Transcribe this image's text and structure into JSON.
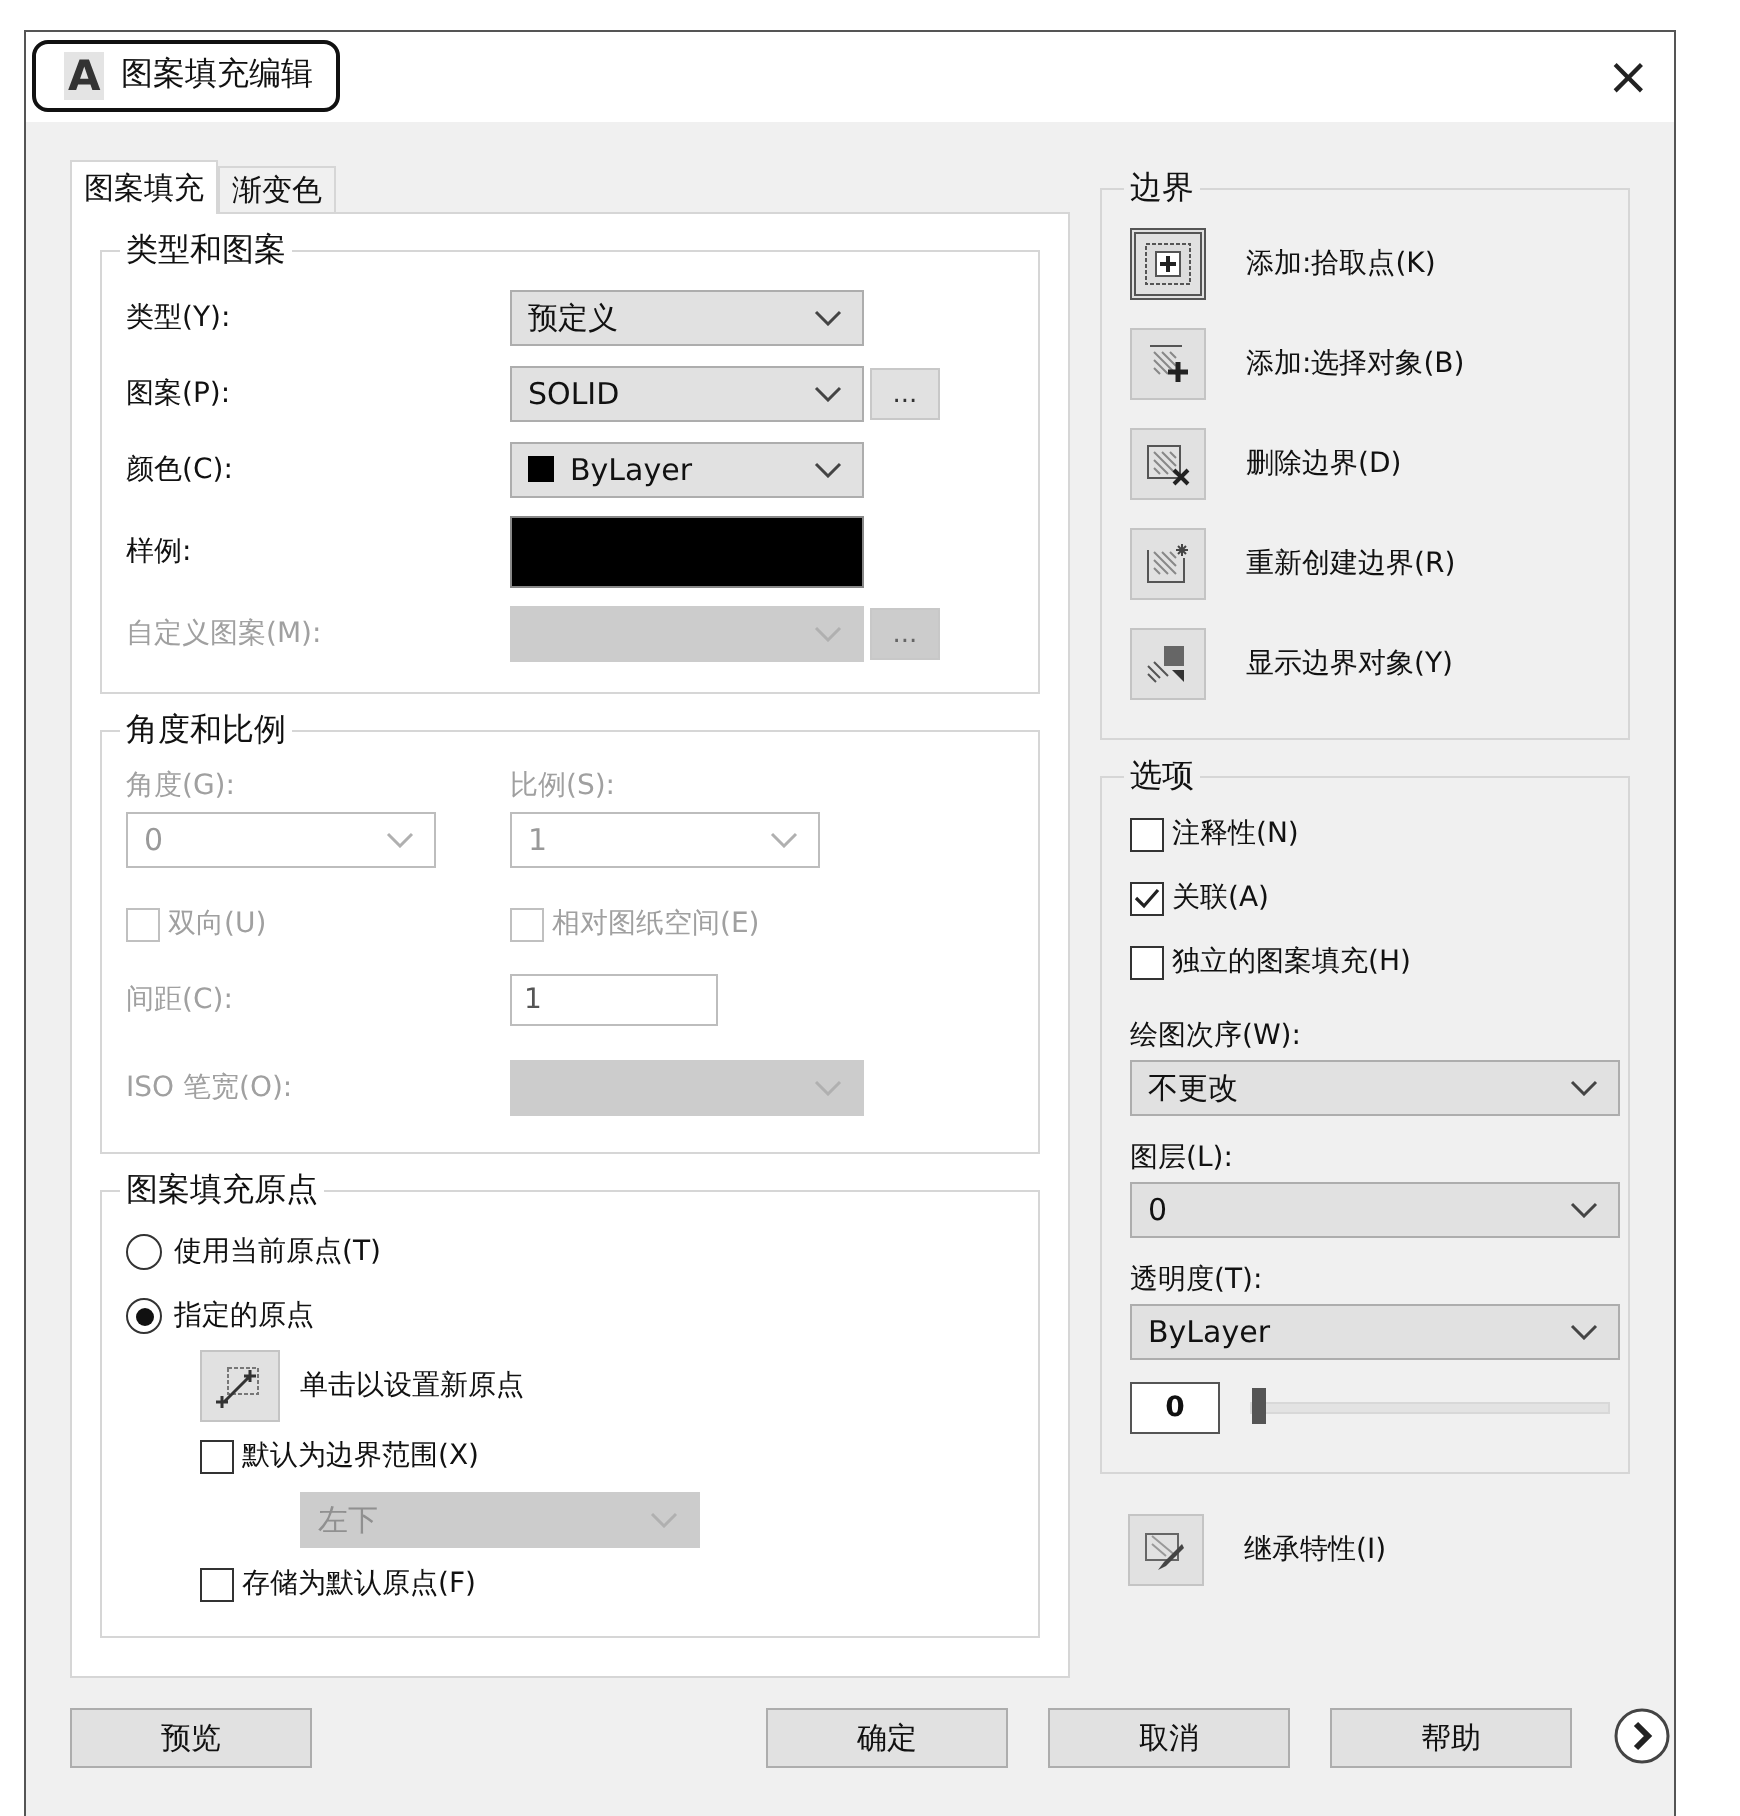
{
  "window": {
    "logo": "A",
    "title": "图案填充编辑",
    "close": "×"
  },
  "tabs": [
    {
      "label": "图案填充",
      "selected": true
    },
    {
      "label": "渐变色",
      "selected": false
    }
  ],
  "type_pattern": {
    "title": "类型和图案",
    "rows": [
      {
        "kind": "select",
        "label": "类型(Y):",
        "value": "预定义",
        "disabled": false
      },
      {
        "kind": "select",
        "label": "图案(P):",
        "value": "SOLID",
        "disabled": false,
        "browse": "..."
      },
      {
        "kind": "color_select",
        "label": "颜色(C):",
        "value": "ByLayer",
        "disabled": false
      },
      {
        "kind": "swatch",
        "label": "样例:",
        "disabled": false
      },
      {
        "kind": "select",
        "label": "自定义图案(M):",
        "disabled": true,
        "browse": "..."
      }
    ]
  },
  "angle_scale": {
    "title": "角度和比例",
    "disabled": true,
    "angle": {
      "label": "角度(G):",
      "value": "0"
    },
    "scale": {
      "label": "比例(S):",
      "value": "1"
    },
    "checkboxes": [
      {
        "label": "双向(U)",
        "checked": false
      },
      {
        "label": "相对图纸空间(E)",
        "checked": false
      }
    ],
    "spacing": {
      "label": "间距(C):",
      "value": "1"
    },
    "iso": {
      "label": "ISO 笔宽(O):"
    }
  },
  "origin": {
    "title": "图案填充原点",
    "radios": [
      {
        "label": "使用当前原点(T)",
        "selected": false
      },
      {
        "label": "指定的原点",
        "selected": true
      }
    ],
    "set_button": "单击以设置新原点",
    "default_extent": {
      "label": "默认为边界范围(X)",
      "checked": false
    },
    "position": {
      "value": "左下",
      "disabled": true
    },
    "store": {
      "label": "存储为默认原点(F)",
      "checked": false
    }
  },
  "boundaries": {
    "title": "边界",
    "buttons": [
      {
        "kind": "pick",
        "label": "添加:拾取点(K)",
        "selected": true
      },
      {
        "kind": "select",
        "label": "添加:选择对象(B)",
        "selected": false
      },
      {
        "kind": "remove",
        "label": "删除边界(D)",
        "selected": false
      },
      {
        "kind": "recreate",
        "label": "重新创建边界(R)",
        "selected": false
      },
      {
        "kind": "show",
        "label": "显示边界对象(Y)",
        "selected": false
      }
    ]
  },
  "options": {
    "title": "选项",
    "checkboxes": [
      {
        "label": "注释性(N)",
        "checked": false
      },
      {
        "label": "关联(A)",
        "checked": true
      },
      {
        "label": "独立的图案填充(H)",
        "checked": false
      }
    ],
    "draw_order": {
      "label": "绘图次序(W):",
      "value": "不更改"
    },
    "layer": {
      "label": "图层(L):",
      "value": "0"
    },
    "transparency": {
      "label": "透明度(T):",
      "value": "ByLayer",
      "reading": "0",
      "level": 0
    }
  },
  "inherit": {
    "label": "继承特性(I)"
  },
  "buttons": [
    {
      "label": "预览"
    },
    {
      "label": "确定"
    },
    {
      "label": "取消"
    },
    {
      "label": "帮助"
    }
  ]
}
